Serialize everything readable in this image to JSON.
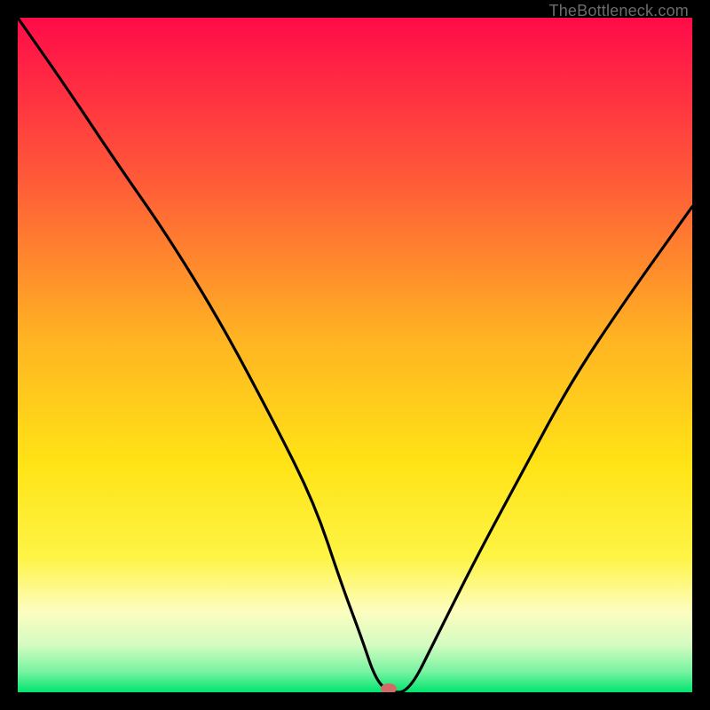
{
  "watermark": "TheBottleneck.com",
  "chart_data": {
    "type": "line",
    "title": "",
    "xlabel": "",
    "ylabel": "",
    "xlim": [
      0,
      100
    ],
    "ylim": [
      0,
      100
    ],
    "background_gradient": [
      "#ff0b49",
      "#ff6e36",
      "#ffc820",
      "#ffe915",
      "#fdfdc0",
      "#b4fdb4",
      "#00e46e"
    ],
    "marker": {
      "x": 55,
      "y": 0,
      "color": "#d36a6a"
    },
    "series": [
      {
        "name": "bottleneck-curve",
        "x": [
          0,
          7,
          15,
          22,
          30,
          38,
          44,
          48,
          51,
          53,
          55,
          58,
          62,
          68,
          75,
          82,
          90,
          100
        ],
        "values": [
          100,
          90,
          78,
          68,
          55,
          40,
          28,
          16,
          8,
          2,
          0,
          0,
          8,
          20,
          33,
          46,
          58,
          72
        ]
      }
    ]
  }
}
